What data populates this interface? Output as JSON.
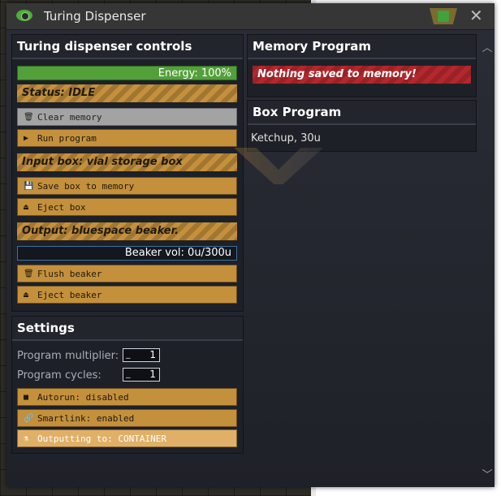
{
  "window": {
    "title": "Turing Dispenser"
  },
  "controls": {
    "panel_title": "Turing dispenser controls",
    "energy_label": "Energy: 100%",
    "energy_fraction": 1.0,
    "status": "Status: IDLE",
    "clear_memory": "Clear memory",
    "run_program": "Run program",
    "input_box": "Input box: vial storage box",
    "save_box": "Save box to memory",
    "eject_box": "Eject box",
    "output": "Output: bluespace beaker.",
    "beaker_vol": "Beaker vol: 0u/300u",
    "flush_beaker": "Flush beaker",
    "eject_beaker": "Eject beaker"
  },
  "settings": {
    "panel_title": "Settings",
    "program_multiplier_label": "Program multiplier:",
    "program_multiplier_value": "1",
    "program_cycles_label": "Program cycles:",
    "program_cycles_value": "1",
    "autorun": "Autorun: disabled",
    "smartlink": "Smartlink: enabled",
    "outputting": "Outputting to: CONTAINER"
  },
  "memory": {
    "panel_title": "Memory Program",
    "notice": "Nothing saved to memory!"
  },
  "box_program": {
    "panel_title": "Box Program",
    "content": "Ketchup, 30u"
  },
  "colors": {
    "button": "#c4903c",
    "energy": "#53a03a",
    "danger": "#b3282c"
  }
}
